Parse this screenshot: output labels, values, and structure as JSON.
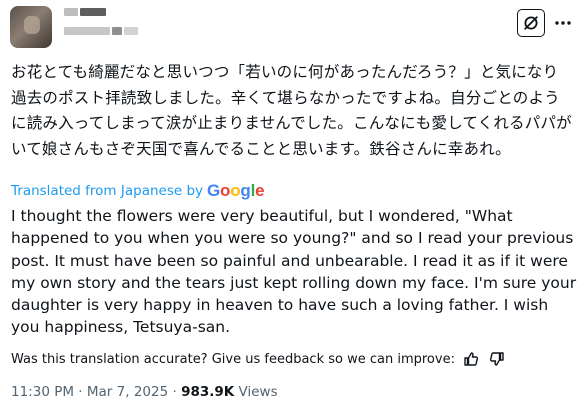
{
  "post": {
    "japanese_text": "お花とても綺麗だなと思いつつ「若いのに何があったんだろう？」と気になり過去のポスト拝読致しました。辛くて堪らなかったですよね。自分ごとのように読み入ってしまって涙が止まりませんでした。こんなにも愛してくれるパパがいて娘さんもさぞ天国で喜んでることと思います。鉄谷さんに幸あれ。",
    "translated_label": "Translated from Japanese by",
    "translator_brand": "Google",
    "english_text": "I thought the flowers were very beautiful, but I wondered, \"What happened to you when you were so young?\" and so I read your previous post. It must have been so painful and unbearable. I read it as if it were my own story and the tears just kept rolling down my face. I'm sure your daughter is very happy in heaven to have such a loving father. I wish you happiness, Tetsuya-san.",
    "feedback_prompt": "Was this translation accurate? Give us feedback so we can improve:",
    "time": "11:30 PM",
    "separator": "·",
    "date": "Mar 7, 2025",
    "views_count": "983.9K",
    "views_label": "Views"
  },
  "icons": {
    "grok": "grok-icon",
    "more": "more-options-icon",
    "thumbs_up": "thumbs-up-icon",
    "thumbs_down": "thumbs-down-icon"
  },
  "colors": {
    "text": "#0f1419",
    "secondary": "#536471",
    "link": "#1d9bf0"
  }
}
